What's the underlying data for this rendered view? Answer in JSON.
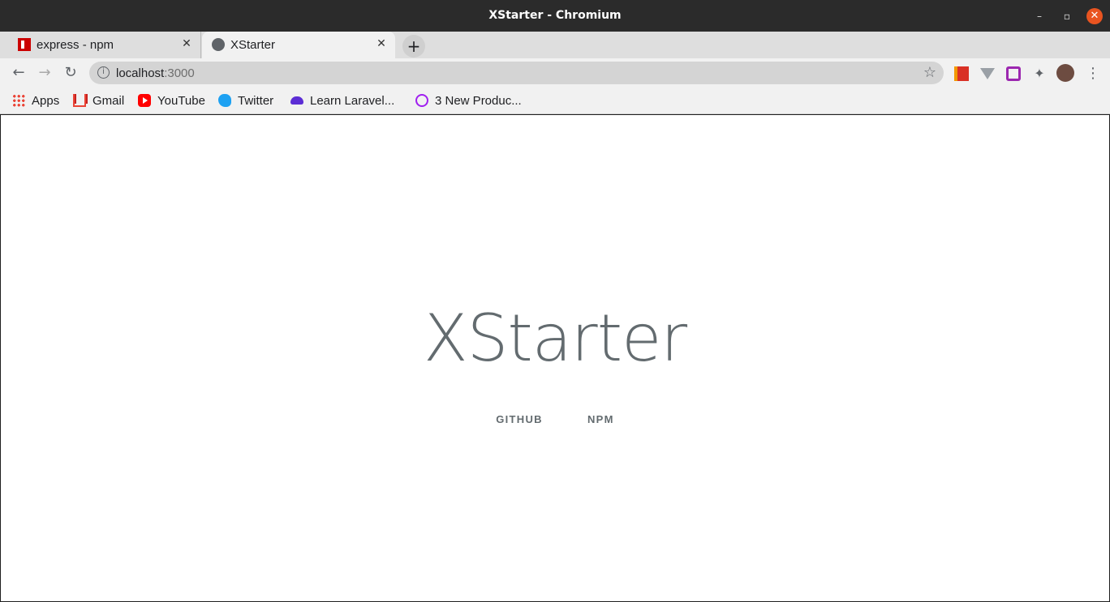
{
  "window": {
    "title": "XStarter - Chromium",
    "controls": {
      "minimize": "–",
      "maximize": "▫",
      "close": "✕"
    }
  },
  "tabs": [
    {
      "label": "express - npm",
      "favicon": "npm-icon",
      "active": false,
      "close": "✕"
    },
    {
      "label": "XStarter",
      "favicon": "globe-icon",
      "active": true,
      "close": "✕"
    }
  ],
  "new_tab": "+",
  "toolbar": {
    "back": "←",
    "forward": "→",
    "reload": "↻",
    "url_host": "localhost",
    "url_port": ":3000",
    "info": "i",
    "star": "☆",
    "extensions": [
      "book-icon",
      "vue-devtools-icon",
      "square-extension-icon",
      "puzzle-icon",
      "profile-avatar"
    ],
    "puzzle": "✦",
    "menu": "⋮"
  },
  "bookmarks": [
    {
      "label": "Apps",
      "icon": "apps-grid-icon"
    },
    {
      "label": "Gmail",
      "icon": "gmail-icon"
    },
    {
      "label": "YouTube",
      "icon": "youtube-icon"
    },
    {
      "label": "Twitter",
      "icon": "twitter-icon"
    },
    {
      "label": "Learn Laravel...",
      "icon": "laravel-cloud-icon"
    },
    {
      "label": "3 New Produc...",
      "icon": "producthunt-icon"
    }
  ],
  "page": {
    "title": "XStarter",
    "links": [
      {
        "label": "GITHUB"
      },
      {
        "label": "NPM"
      }
    ]
  },
  "colors": {
    "text_gray": "#636b6f",
    "close_button": "#e95420",
    "title_bar": "#2b2b2b"
  }
}
